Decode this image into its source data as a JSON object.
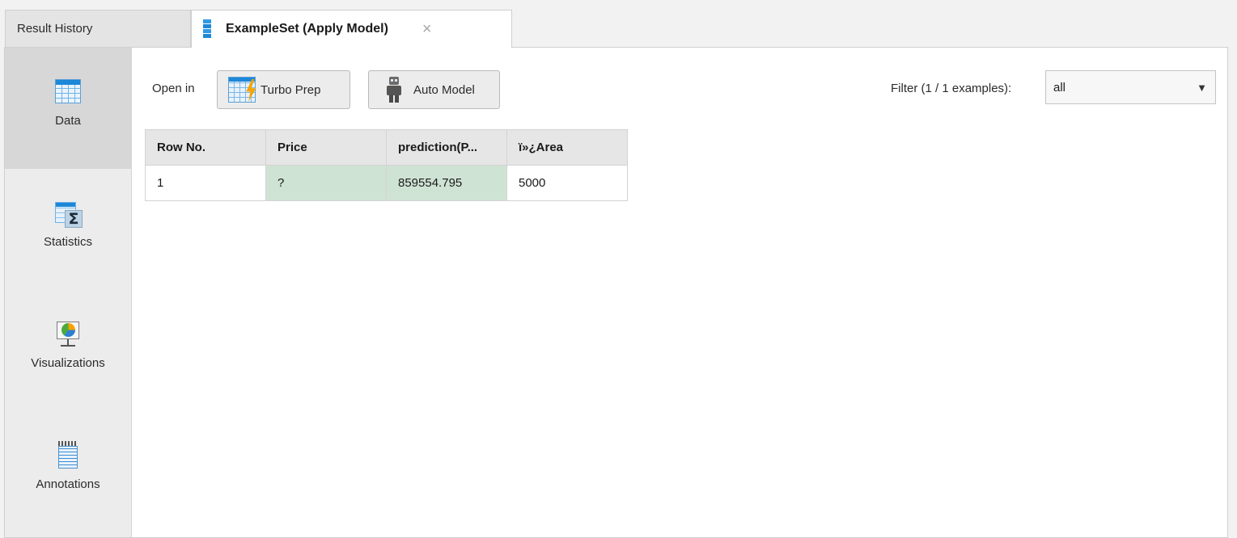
{
  "tabs": {
    "history_label": "Result History",
    "active_label": "ExampleSet (Apply Model)",
    "close_glyph": "×"
  },
  "sidebar": {
    "items": [
      {
        "label": "Data",
        "icon": "data-table-icon",
        "active": true
      },
      {
        "label": "Statistics",
        "icon": "statistics-icon",
        "active": false
      },
      {
        "label": "Visualizations",
        "icon": "visualization-icon",
        "active": false
      },
      {
        "label": "Annotations",
        "icon": "annotations-icon",
        "active": false
      }
    ]
  },
  "toolbar": {
    "open_in_label": "Open in",
    "turbo_prep_label": "Turbo Prep",
    "auto_model_label": "Auto Model",
    "filter_label": "Filter (1 / 1 examples):",
    "filter_value": "all"
  },
  "table": {
    "columns": [
      "Row No.",
      "Price",
      "prediction(P...",
      "ï»¿Area"
    ],
    "rows": [
      [
        "1",
        "?",
        "859554.795",
        "5000"
      ]
    ],
    "special_column_color": "#cfe3d4"
  }
}
